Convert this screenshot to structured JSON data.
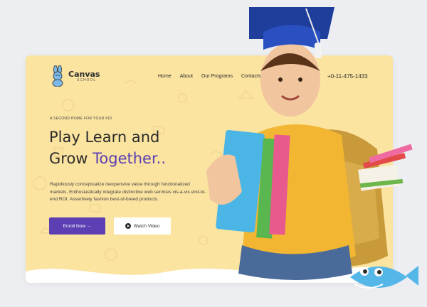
{
  "brand": {
    "name": "Canvas",
    "sub": "SCHOOL"
  },
  "nav": {
    "items": [
      "Home",
      "About",
      "Our Programs",
      "Contacts"
    ]
  },
  "phone": "+0-11-475-1433",
  "hero": {
    "tagline": "A SECOND HOME FOR YOUR KID",
    "headline_line1": "Play Learn and",
    "headline_line2_prefix": "Grow ",
    "headline_accent": "Together..",
    "description": "Rapidiously conceptualize inexpensive value through functionalized markets. Enthusiastically integrate distinctive web services vis-a-vis end-to-end ROI. Assertively fashion best-of-breed products.",
    "enroll_label": "Enroll Now →",
    "video_label": "Watch Video"
  },
  "colors": {
    "accent": "#5b3fb3",
    "card_bg": "#fbe3a0",
    "page_bg": "#eceef2"
  }
}
